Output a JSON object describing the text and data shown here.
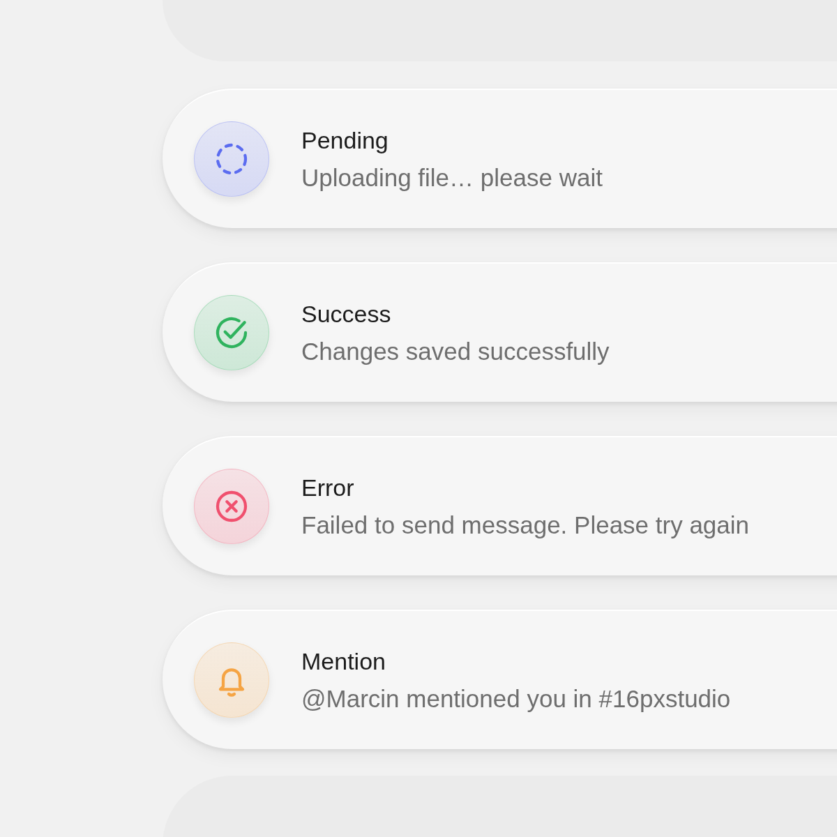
{
  "notifications": [
    {
      "kind": "pending",
      "color": "#5b6cf0",
      "title": "Pending",
      "message": "Uploading file… please wait"
    },
    {
      "kind": "success",
      "color": "#2fb35e",
      "title": "Success",
      "message": "Changes saved successfully"
    },
    {
      "kind": "error",
      "color": "#f0506e",
      "title": "Error",
      "message": "Failed to send message. Please try again"
    },
    {
      "kind": "mention",
      "color": "#f5a444",
      "title": "Mention",
      "message": "@Marcin mentioned you in #16pxstudio"
    }
  ]
}
